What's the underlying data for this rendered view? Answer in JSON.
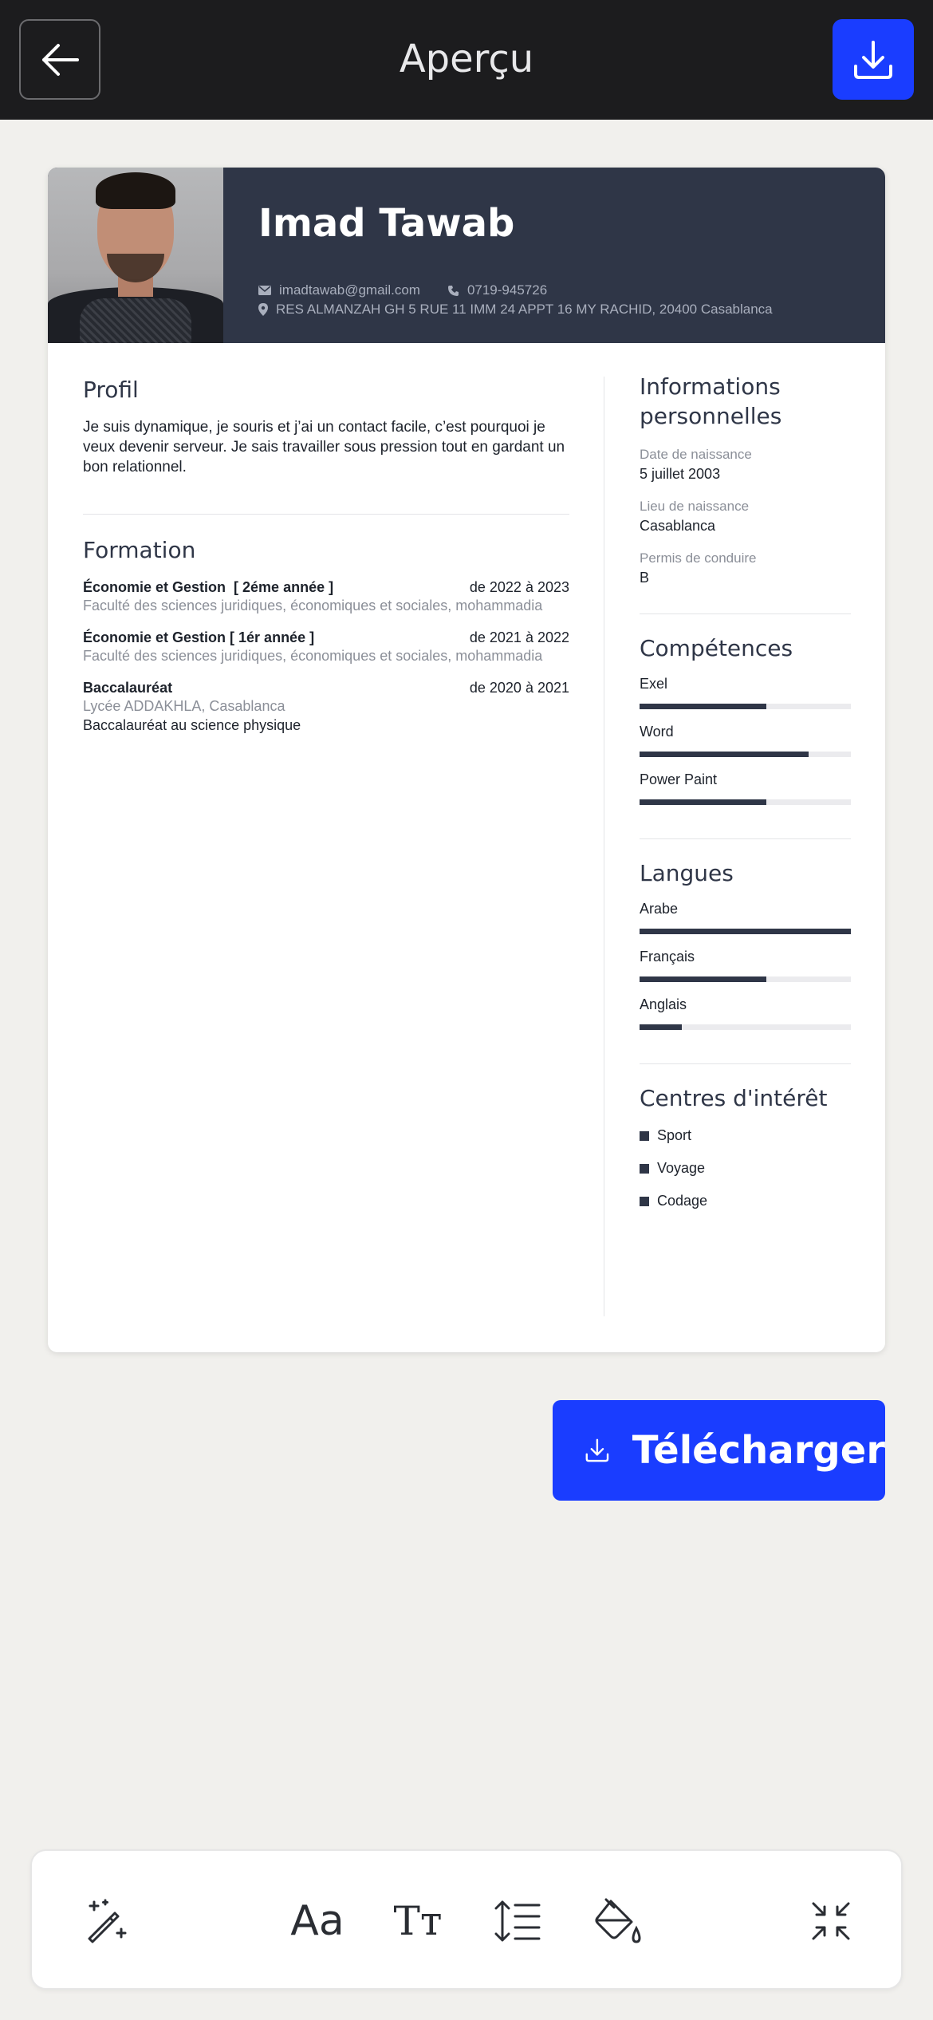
{
  "topbar": {
    "title": "Aperçu",
    "back_icon": "arrow-left-icon",
    "download_icon": "download-icon"
  },
  "cv": {
    "name": "Imad Tawab",
    "email": "imadtawab@gmail.com",
    "phone": "0719-945726",
    "address": "RES ALMANZAH GH 5 RUE 11 IMM 24 APPT 16 MY RACHID, 20400 Casablanca",
    "profil": {
      "title": "Profil",
      "text": "Je suis dynamique, je souris et j’ai un contact facile, c’est pourquoi je veux devenir serveur. Je sais travailler sous pression tout en gardant un bon relationnel."
    },
    "formation": {
      "title": "Formation",
      "items": [
        {
          "title": "Économie et Gestion  [ 2éme année ]",
          "dates": "de 2022 à 2023",
          "school": "Faculté des sciences juridiques, économiques et sociales, mohammadia",
          "description": ""
        },
        {
          "title": "Économie et Gestion [ 1ér année ]",
          "dates": "de 2021 à 2022",
          "school": "Faculté des sciences juridiques, économiques et sociales, mohammadia",
          "description": ""
        },
        {
          "title": "Baccalauréat",
          "dates": "de 2020 à 2021",
          "school": "Lycée ADDAKHLA, Casablanca",
          "description": "Baccalauréat au science physique"
        }
      ]
    },
    "personal": {
      "title": "Informations personnelles",
      "birth_date_label": "Date de naissance",
      "birth_date": "5 juillet 2003",
      "birth_place_label": "Lieu de naissance",
      "birth_place": "Casablanca",
      "license_label": "Permis de conduire",
      "license": "B"
    },
    "skills": {
      "title": "Compétences",
      "items": [
        {
          "name": "Exel",
          "level": 0.6
        },
        {
          "name": "Word",
          "level": 0.8
        },
        {
          "name": "Power Paint",
          "level": 0.6
        }
      ]
    },
    "languages": {
      "title": "Langues",
      "items": [
        {
          "name": "Arabe",
          "level": 1.0
        },
        {
          "name": "Français",
          "level": 0.6
        },
        {
          "name": "Anglais",
          "level": 0.2
        }
      ]
    },
    "interests": {
      "title": "Centres d'intérêt",
      "items": [
        "Sport",
        "Voyage",
        "Codage"
      ]
    }
  },
  "download_button": {
    "label": "Télécharger",
    "icon": "download-icon"
  },
  "toolbar": {
    "tools": [
      {
        "name": "magic-wand-icon"
      },
      {
        "name": "font-family-icon",
        "glyph": "Aa"
      },
      {
        "name": "font-size-icon",
        "glyph": "Tт"
      },
      {
        "name": "line-height-icon"
      },
      {
        "name": "paint-bucket-icon"
      },
      {
        "name": "collapse-icon"
      }
    ]
  },
  "colors": {
    "accent": "#1a3dff",
    "header_dark": "#2f3647",
    "topbar": "#1c1c1e"
  }
}
